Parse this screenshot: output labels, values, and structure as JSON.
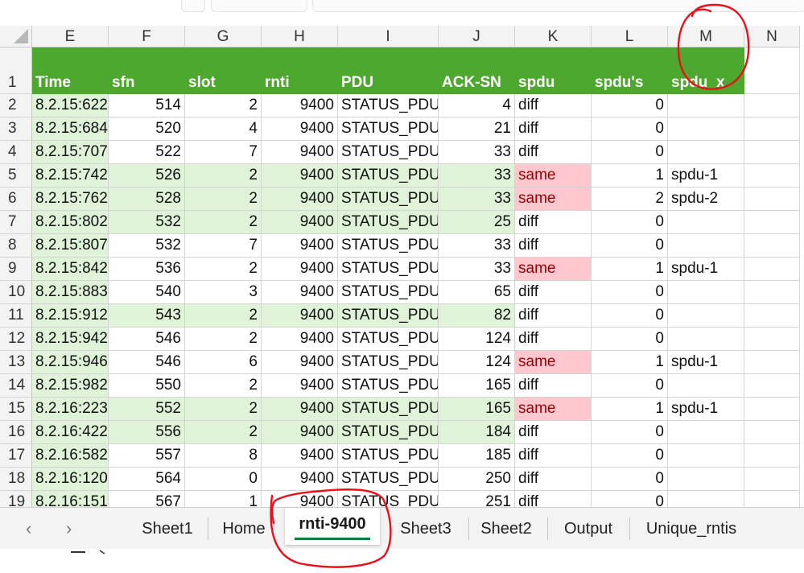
{
  "columns": [
    "E",
    "F",
    "G",
    "H",
    "I",
    "J",
    "K",
    "L",
    "M",
    "N"
  ],
  "header_row": {
    "row_number": "1",
    "labels": [
      "Time",
      "sfn",
      "slot",
      "rnti",
      "PDU",
      "ACK-SN",
      "spdu",
      "spdu's",
      "spdu_x"
    ]
  },
  "rows": [
    {
      "n": "2",
      "time": "8.2.15:622",
      "sfn": "514",
      "slot": "2",
      "rnti": "9400",
      "pdu": "STATUS_PDU",
      "ack": "4",
      "spdu": "diff",
      "count": "0",
      "x": ""
    },
    {
      "n": "3",
      "time": "8.2.15:684",
      "sfn": "520",
      "slot": "4",
      "rnti": "9400",
      "pdu": "STATUS_PDU",
      "ack": "21",
      "spdu": "diff",
      "count": "0",
      "x": ""
    },
    {
      "n": "4",
      "time": "8.2.15:707",
      "sfn": "522",
      "slot": "7",
      "rnti": "9400",
      "pdu": "STATUS_PDU",
      "ack": "33",
      "spdu": "diff",
      "count": "0",
      "x": ""
    },
    {
      "n": "5",
      "time": "8.2.15:742",
      "sfn": "526",
      "slot": "2",
      "rnti": "9400",
      "pdu": "STATUS_PDU",
      "ack": "33",
      "spdu": "same",
      "count": "1",
      "x": "spdu-1"
    },
    {
      "n": "6",
      "time": "8.2.15:762",
      "sfn": "528",
      "slot": "2",
      "rnti": "9400",
      "pdu": "STATUS_PDU",
      "ack": "33",
      "spdu": "same",
      "count": "2",
      "x": "spdu-2"
    },
    {
      "n": "7",
      "time": "8.2.15:802",
      "sfn": "532",
      "slot": "2",
      "rnti": "9400",
      "pdu": "STATUS_PDU",
      "ack": "25",
      "spdu": "diff",
      "count": "0",
      "x": ""
    },
    {
      "n": "8",
      "time": "8.2.15:807",
      "sfn": "532",
      "slot": "7",
      "rnti": "9400",
      "pdu": "STATUS_PDU",
      "ack": "33",
      "spdu": "diff",
      "count": "0",
      "x": ""
    },
    {
      "n": "9",
      "time": "8.2.15:842",
      "sfn": "536",
      "slot": "2",
      "rnti": "9400",
      "pdu": "STATUS_PDU",
      "ack": "33",
      "spdu": "same",
      "count": "1",
      "x": "spdu-1"
    },
    {
      "n": "10",
      "time": "8.2.15:883",
      "sfn": "540",
      "slot": "3",
      "rnti": "9400",
      "pdu": "STATUS_PDU",
      "ack": "65",
      "spdu": "diff",
      "count": "0",
      "x": ""
    },
    {
      "n": "11",
      "time": "8.2.15:912",
      "sfn": "543",
      "slot": "2",
      "rnti": "9400",
      "pdu": "STATUS_PDU",
      "ack": "82",
      "spdu": "diff",
      "count": "0",
      "x": ""
    },
    {
      "n": "12",
      "time": "8.2.15:942",
      "sfn": "546",
      "slot": "2",
      "rnti": "9400",
      "pdu": "STATUS_PDU",
      "ack": "124",
      "spdu": "diff",
      "count": "0",
      "x": ""
    },
    {
      "n": "13",
      "time": "8.2.15:946",
      "sfn": "546",
      "slot": "6",
      "rnti": "9400",
      "pdu": "STATUS_PDU",
      "ack": "124",
      "spdu": "same",
      "count": "1",
      "x": "spdu-1"
    },
    {
      "n": "14",
      "time": "8.2.15:982",
      "sfn": "550",
      "slot": "2",
      "rnti": "9400",
      "pdu": "STATUS_PDU",
      "ack": "165",
      "spdu": "diff",
      "count": "0",
      "x": ""
    },
    {
      "n": "15",
      "time": "8.2.16:223",
      "sfn": "552",
      "slot": "2",
      "rnti": "9400",
      "pdu": "STATUS_PDU",
      "ack": "165",
      "spdu": "same",
      "count": "1",
      "x": "spdu-1"
    },
    {
      "n": "16",
      "time": "8.2.16:422",
      "sfn": "556",
      "slot": "2",
      "rnti": "9400",
      "pdu": "STATUS_PDU",
      "ack": "184",
      "spdu": "diff",
      "count": "0",
      "x": ""
    },
    {
      "n": "17",
      "time": "8.2.16:582",
      "sfn": "557",
      "slot": "8",
      "rnti": "9400",
      "pdu": "STATUS_PDU",
      "ack": "185",
      "spdu": "diff",
      "count": "0",
      "x": ""
    },
    {
      "n": "18",
      "time": "8.2.16:120",
      "sfn": "564",
      "slot": "0",
      "rnti": "9400",
      "pdu": "STATUS_PDU",
      "ack": "250",
      "spdu": "diff",
      "count": "0",
      "x": ""
    },
    {
      "n": "19",
      "time": "8.2.16:151",
      "sfn": "567",
      "slot": "1",
      "rnti": "9400",
      "pdu": "STATUS_PDU",
      "ack": "251",
      "spdu": "diff",
      "count": "0",
      "x": ""
    }
  ],
  "green_rows": [
    "5",
    "6",
    "7",
    "11",
    "15",
    "16"
  ],
  "sheet_tabs": [
    "Sheet1",
    "Home",
    "rnti-9400",
    "Sheet3",
    "Sheet2",
    "Output",
    "Unique_rntis"
  ],
  "active_tab": "rnti-9400",
  "nav_icons": [
    "chevron-left-icon",
    "chevron-right-icon"
  ],
  "colors": {
    "header_green": "#4ea72e",
    "row_green": "#dff3d8",
    "same_pink": "#ffc7ce",
    "same_text": "#9c0006",
    "annotation_red": "#e8111b",
    "active_tab_underline": "#107c41"
  }
}
